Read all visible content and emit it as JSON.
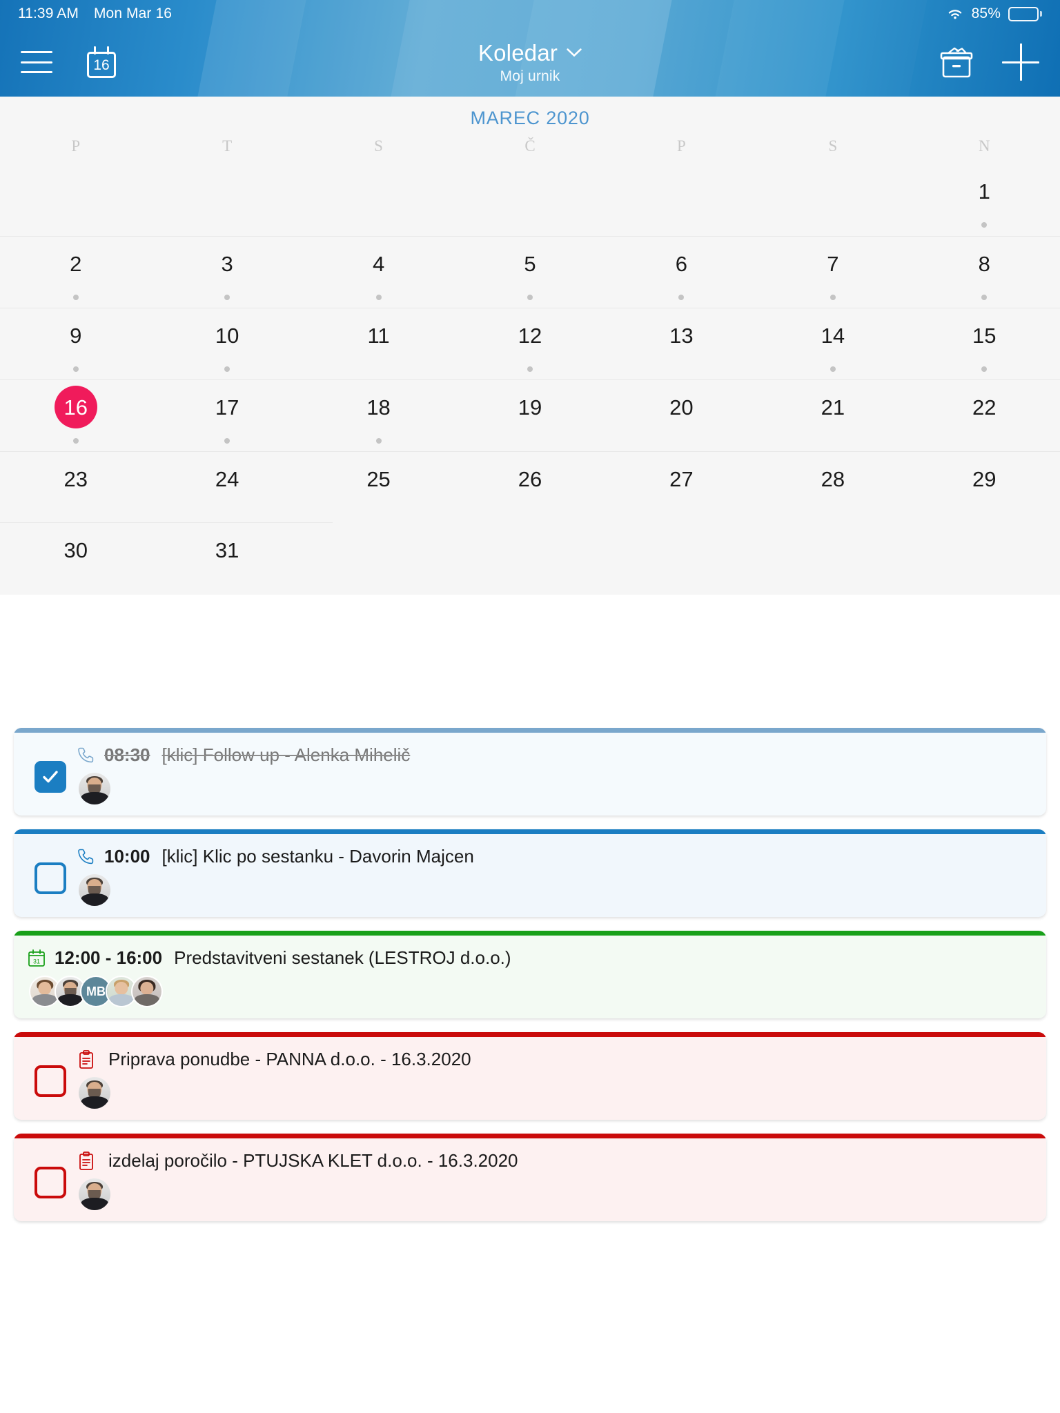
{
  "statusbar": {
    "time": "11:39 AM",
    "date": "Mon Mar 16",
    "battery_percent": "85%",
    "wifi_icon": "wifi-icon",
    "battery_icon": "battery-icon"
  },
  "header": {
    "menu_icon": "hamburger-menu-icon",
    "calendar_icon": "calendar-day-icon",
    "calendar_icon_day": "16",
    "title": "Koledar",
    "title_chevron_icon": "chevron-down-icon",
    "subtitle": "Moj urnik",
    "archive_icon": "archive-box-icon",
    "add_icon": "plus-icon",
    "accent": "#1b7ec2"
  },
  "calendar": {
    "month_label": "MAREC 2020",
    "month_color": "#4d95cf",
    "weekdays": [
      "P",
      "T",
      "S",
      "Č",
      "P",
      "S",
      "N"
    ],
    "today": "16",
    "today_color": "#f01b5b",
    "weeks": [
      [
        {
          "day": "",
          "dot": false,
          "empty": true
        },
        {
          "day": "",
          "dot": false,
          "empty": true
        },
        {
          "day": "",
          "dot": false,
          "empty": true
        },
        {
          "day": "",
          "dot": false,
          "empty": true
        },
        {
          "day": "",
          "dot": false,
          "empty": true
        },
        {
          "day": "",
          "dot": false,
          "empty": true
        },
        {
          "day": "1",
          "dot": true,
          "empty": false
        }
      ],
      [
        {
          "day": "2",
          "dot": true,
          "empty": false
        },
        {
          "day": "3",
          "dot": true,
          "empty": false
        },
        {
          "day": "4",
          "dot": true,
          "empty": false
        },
        {
          "day": "5",
          "dot": true,
          "empty": false
        },
        {
          "day": "6",
          "dot": true,
          "empty": false
        },
        {
          "day": "7",
          "dot": true,
          "empty": false
        },
        {
          "day": "8",
          "dot": true,
          "empty": false
        }
      ],
      [
        {
          "day": "9",
          "dot": true,
          "empty": false
        },
        {
          "day": "10",
          "dot": true,
          "empty": false
        },
        {
          "day": "11",
          "dot": false,
          "empty": false
        },
        {
          "day": "12",
          "dot": true,
          "empty": false
        },
        {
          "day": "13",
          "dot": false,
          "empty": false
        },
        {
          "day": "14",
          "dot": true,
          "empty": false
        },
        {
          "day": "15",
          "dot": true,
          "empty": false
        }
      ],
      [
        {
          "day": "16",
          "dot": true,
          "empty": false,
          "today": true
        },
        {
          "day": "17",
          "dot": true,
          "empty": false
        },
        {
          "day": "18",
          "dot": true,
          "empty": false
        },
        {
          "day": "19",
          "dot": false,
          "empty": false
        },
        {
          "day": "20",
          "dot": false,
          "empty": false
        },
        {
          "day": "21",
          "dot": false,
          "empty": false
        },
        {
          "day": "22",
          "dot": false,
          "empty": false
        }
      ],
      [
        {
          "day": "23",
          "dot": false,
          "empty": false
        },
        {
          "day": "24",
          "dot": false,
          "empty": false
        },
        {
          "day": "25",
          "dot": false,
          "empty": false
        },
        {
          "day": "26",
          "dot": false,
          "empty": false
        },
        {
          "day": "27",
          "dot": false,
          "empty": false
        },
        {
          "day": "28",
          "dot": false,
          "empty": false
        },
        {
          "day": "29",
          "dot": false,
          "empty": false
        }
      ],
      [
        {
          "day": "30",
          "dot": false,
          "empty": false
        },
        {
          "day": "31",
          "dot": false,
          "empty": false
        },
        {
          "day": "",
          "dot": false,
          "empty": true
        },
        {
          "day": "",
          "dot": false,
          "empty": true
        },
        {
          "day": "",
          "dot": false,
          "empty": true
        },
        {
          "day": "",
          "dot": false,
          "empty": true
        },
        {
          "day": "",
          "dot": false,
          "empty": true
        }
      ]
    ]
  },
  "events": [
    {
      "time": "08:30",
      "title": "[klic] Follow up - Alenka Mihelič",
      "icon": "phone-icon",
      "accent": "#7aa7cc",
      "checkbox": "checked",
      "completed": true,
      "attendees": [
        "man"
      ]
    },
    {
      "time": "10:00",
      "title": "[klic] Klic po sestanku - Davorin Majcen",
      "icon": "phone-icon",
      "accent": "#1b7ec2",
      "checkbox": "unchecked",
      "completed": false,
      "attendees": [
        "man"
      ]
    },
    {
      "time": "12:00 - 16:00",
      "title": "Predstavitveni sestanek (LESTROJ d.o.o.)",
      "icon": "calendar-icon",
      "accent": "#18a019",
      "checkbox": "none",
      "completed": false,
      "attendees": [
        "woman",
        "man",
        "MB",
        "blond",
        "dark"
      ]
    },
    {
      "time": "",
      "title": "Priprava ponudbe - PANNA d.o.o. - 16.3.2020",
      "icon": "clipboard-icon",
      "accent": "#ca0b0b",
      "checkbox": "unchecked",
      "completed": false,
      "attendees": [
        "man"
      ]
    },
    {
      "time": "",
      "title": "izdelaj poročilo - PTUJSKA KLET d.o.o. - 16.3.2020",
      "icon": "clipboard-icon",
      "accent": "#ca0b0b",
      "checkbox": "unchecked",
      "completed": false,
      "attendees": [
        "man"
      ]
    }
  ]
}
